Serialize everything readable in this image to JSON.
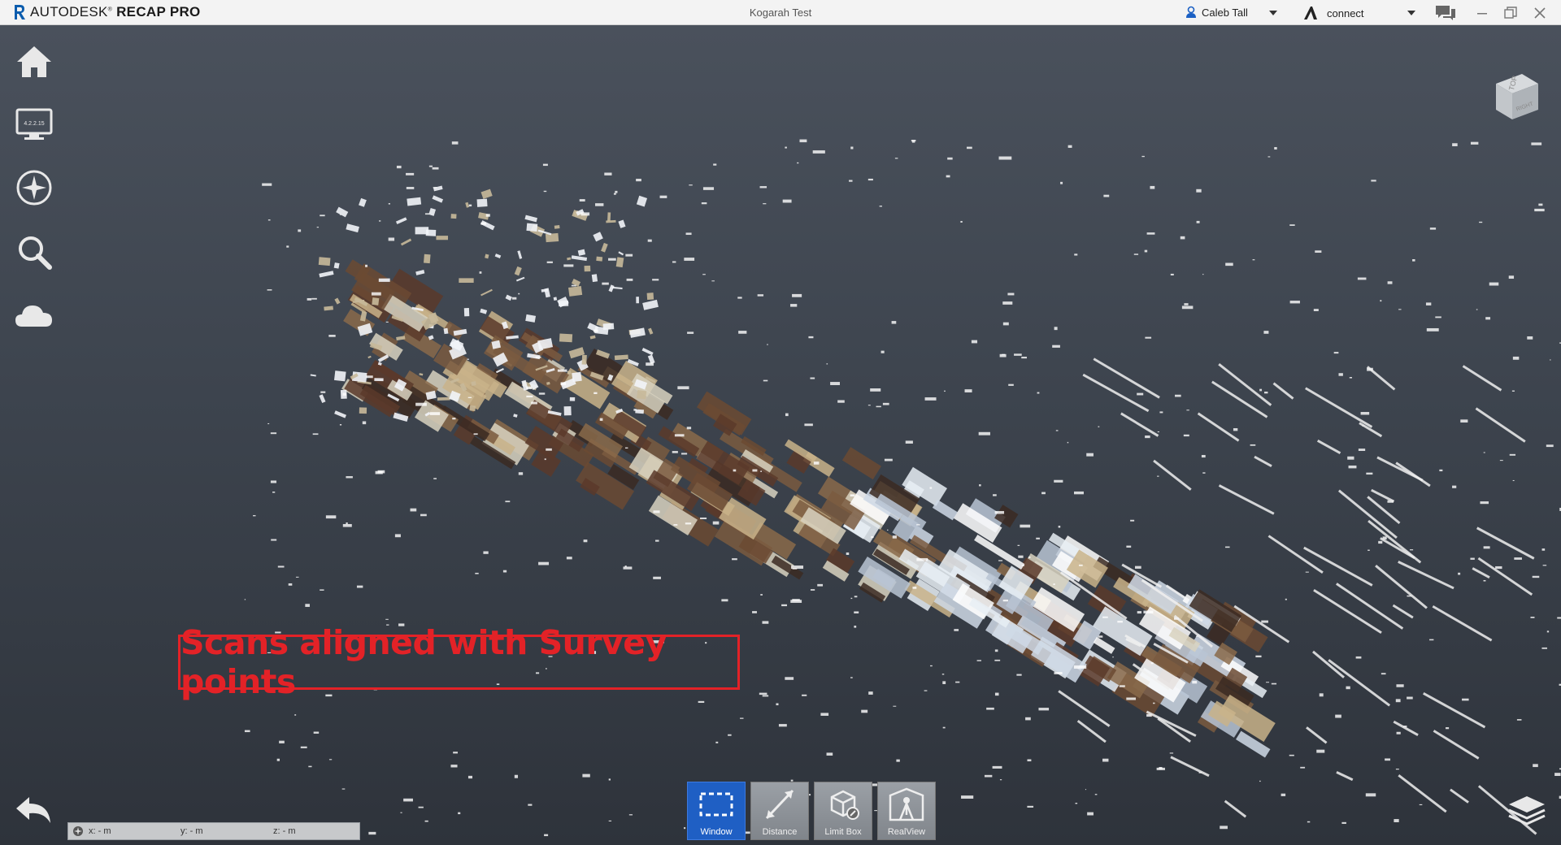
{
  "app": {
    "brand_light": "AUTODESK",
    "brand_bold": "RECAP PRO",
    "document_title": "Kogarah Test",
    "user_name": "Caleb Tall",
    "hub_name": "connect"
  },
  "left_toolbar": {
    "items": [
      "home-icon",
      "monitor-icon",
      "compass-icon",
      "search-icon",
      "cloud-icon"
    ],
    "monitor_label": "4.2.2.15"
  },
  "annotation": {
    "text": "Scans aligned with Survey points",
    "color": "#e32227"
  },
  "coordinates": {
    "x": "x:  -  m",
    "y": "y:  -  m",
    "z": "z:  -  m"
  },
  "bottom_toolbar": {
    "tools": [
      {
        "label": "Window",
        "icon": "selection-window-icon",
        "active": true
      },
      {
        "label": "Distance",
        "icon": "distance-icon",
        "active": false
      },
      {
        "label": "Limit Box",
        "icon": "limit-box-icon",
        "active": false
      },
      {
        "label": "RealView",
        "icon": "realview-icon",
        "active": false
      }
    ]
  },
  "viewcube": {
    "top_label": "TOP",
    "side_label": "RIGHT"
  },
  "colors": {
    "accent": "#1f5fc4",
    "background": "#3f4652"
  }
}
